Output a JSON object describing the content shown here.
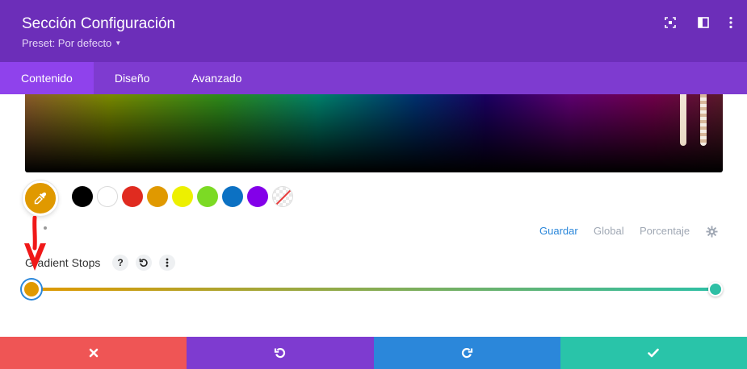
{
  "header": {
    "title": "Sección Configuración",
    "preset_label": "Preset: Por defecto",
    "icons": [
      "fullscreen-icon",
      "sidebar-layout-icon",
      "more-options-icon"
    ]
  },
  "tabs": [
    {
      "label": "Contenido",
      "active": true
    },
    {
      "label": "Diseño",
      "active": false
    },
    {
      "label": "Avanzado",
      "active": false
    }
  ],
  "colors": {
    "header_bg": "#6c2eb9",
    "tabs_bg": "#7e3bd0",
    "active_tab_bg": "#8f42ec",
    "link_active": "#2b87da",
    "gradient_start": "#e09900",
    "gradient_end": "#2ebfa5",
    "cancel": "#ef5555",
    "undo": "#7e3bd0",
    "redo": "#2b87da",
    "save": "#29c4a9"
  },
  "picker": {
    "selected_color": "#e09900",
    "swatches": [
      "#000000",
      "#ffffff",
      "#e02b20",
      "#e09900",
      "#edf000",
      "#7cda24",
      "#0c71c3",
      "#8300e9",
      "transparent"
    ]
  },
  "links": {
    "save": "Guardar",
    "global": "Global",
    "percent": "Porcentaje"
  },
  "gradient": {
    "label": "Gradient Stops",
    "help_glyph": "?",
    "stops": [
      {
        "color": "#e09900",
        "position_percent": 0
      },
      {
        "color": "#2ebfa5",
        "position_percent": 100
      }
    ]
  },
  "footer": {
    "buttons": [
      "cancel-button",
      "undo-button",
      "redo-button",
      "save-button"
    ]
  }
}
